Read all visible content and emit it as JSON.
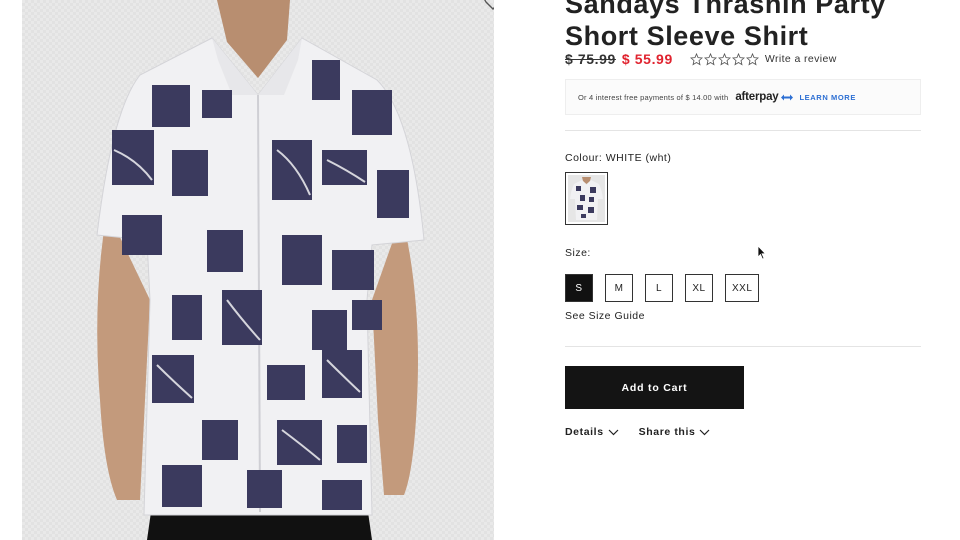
{
  "product": {
    "title_line1": "Sandays Thrashin Party",
    "title_line2": "Short Sleeve Shirt",
    "price_original": "$ 75.99",
    "price_sale": "$ 55.99",
    "rating_stars": 0,
    "review_link": "Write a review"
  },
  "afterpay": {
    "text": "Or 4 interest free payments of $ 14.00 with",
    "logo": "afterpay",
    "learn_more": "LEARN MORE",
    "brand_color": "#2d6fd3"
  },
  "colour": {
    "label": "Colour: WHITE (wht)"
  },
  "size": {
    "label": "Size:",
    "options": [
      "S",
      "M",
      "L",
      "XL",
      "XXL"
    ],
    "selected": "S",
    "guide_link": "See Size Guide"
  },
  "actions": {
    "add_to_cart": "Add to Cart",
    "details": "Details",
    "share": "Share this"
  },
  "colors": {
    "sale_price": "#e0232f",
    "primary_button": "#141414"
  },
  "icons": {
    "wishlist": "heart-icon",
    "star": "star-outline-icon",
    "chevron": "chevron-down-icon",
    "cursor": "mouse-pointer-icon"
  }
}
